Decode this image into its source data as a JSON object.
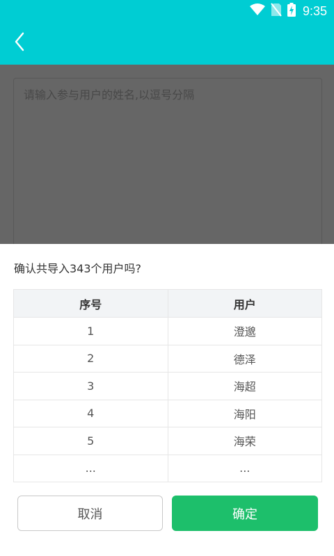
{
  "status_bar": {
    "time": "9:35",
    "icons": [
      "wifi-icon",
      "no-sim-icon",
      "battery-charging-icon"
    ]
  },
  "app_bar": {
    "back_icon": "chevron-left-icon",
    "color": "#00cdd3"
  },
  "form": {
    "names_placeholder": "请输入参与用户的姓名,以逗号分隔",
    "names_value": ""
  },
  "dialog": {
    "message": "确认共导入343个用户吗?",
    "table": {
      "headers": [
        "序号",
        "用户"
      ],
      "rows": [
        [
          "1",
          "澄邈"
        ],
        [
          "2",
          "德泽"
        ],
        [
          "3",
          "海超"
        ],
        [
          "4",
          "海阳"
        ],
        [
          "5",
          "海荣"
        ],
        [
          "...",
          "..."
        ]
      ]
    },
    "cancel_label": "取消",
    "confirm_label": "确定",
    "confirm_color": "#1dbf6b"
  }
}
